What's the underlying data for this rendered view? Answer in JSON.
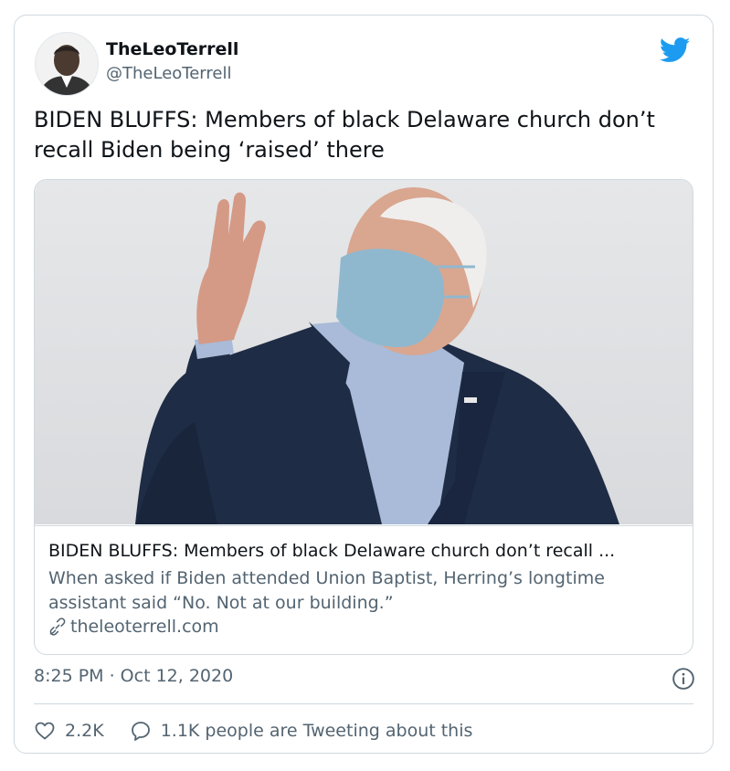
{
  "author": {
    "display_name": "TheLeoTerrell",
    "handle": "@TheLeoTerrell"
  },
  "tweet": {
    "text": "BIDEN BLUFFS: Members of black Delaware church don’t recall Biden being ‘raised’ there",
    "timestamp": "8:25 PM · Oct 12, 2020"
  },
  "link_card": {
    "title": "BIDEN BLUFFS: Members of black Delaware church don’t recall ...",
    "description": "When asked if Biden attended Union Baptist, Herring’s longtime assistant said “No. Not at our building.”",
    "domain": "theleoterrell.com"
  },
  "actions": {
    "likes": "2.2K",
    "conversation": "1.1K people are Tweeting about this"
  },
  "icons": {
    "brand": "twitter-bird-icon",
    "info": "info-icon",
    "like": "heart-icon",
    "reply": "speech-bubble-icon",
    "link": "link-icon"
  },
  "colors": {
    "brand_blue": "#1d9bf0",
    "secondary_text": "#536471",
    "border": "#cfd9de"
  }
}
